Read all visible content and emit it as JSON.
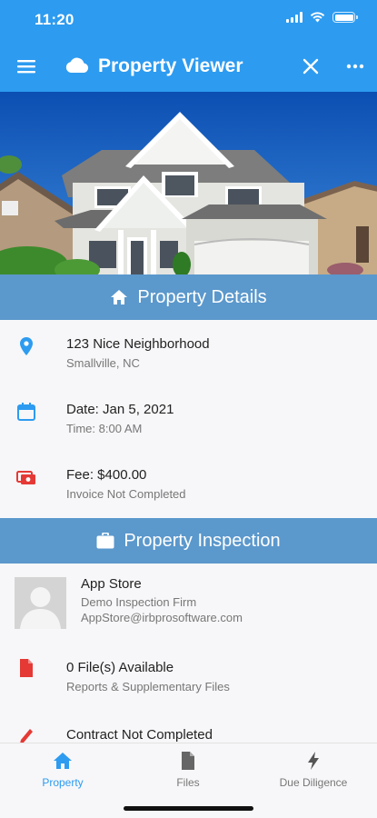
{
  "status": {
    "time": "11:20"
  },
  "header": {
    "title": "Property Viewer"
  },
  "details": {
    "heading": "Property Details",
    "address": {
      "line1": "123 Nice Neighborhood",
      "line2": "Smallville, NC"
    },
    "date": {
      "line1": "Date: Jan 5, 2021",
      "line2": "Time: 8:00 AM"
    },
    "fee": {
      "line1": "Fee: $400.00",
      "line2": "Invoice Not Completed"
    }
  },
  "inspection": {
    "heading": "Property Inspection",
    "inspector": {
      "name": "App Store",
      "firm": "Demo Inspection Firm",
      "email": "AppStore@irbprosoftware.com"
    },
    "files": {
      "line1": "0 File(s) Available",
      "line2": "Reports & Supplementary Files"
    },
    "contract": {
      "line1": "Contract Not Completed"
    }
  },
  "tabs": [
    {
      "label": "Property",
      "icon": "home-icon",
      "active": true
    },
    {
      "label": "Files",
      "icon": "file-icon",
      "active": false
    },
    {
      "label": "Due Diligence",
      "icon": "bolt-icon",
      "active": false
    }
  ],
  "colors": {
    "primary": "#2d9bf0",
    "section_header": "#5b98cc",
    "alert_red": "#e53935"
  }
}
